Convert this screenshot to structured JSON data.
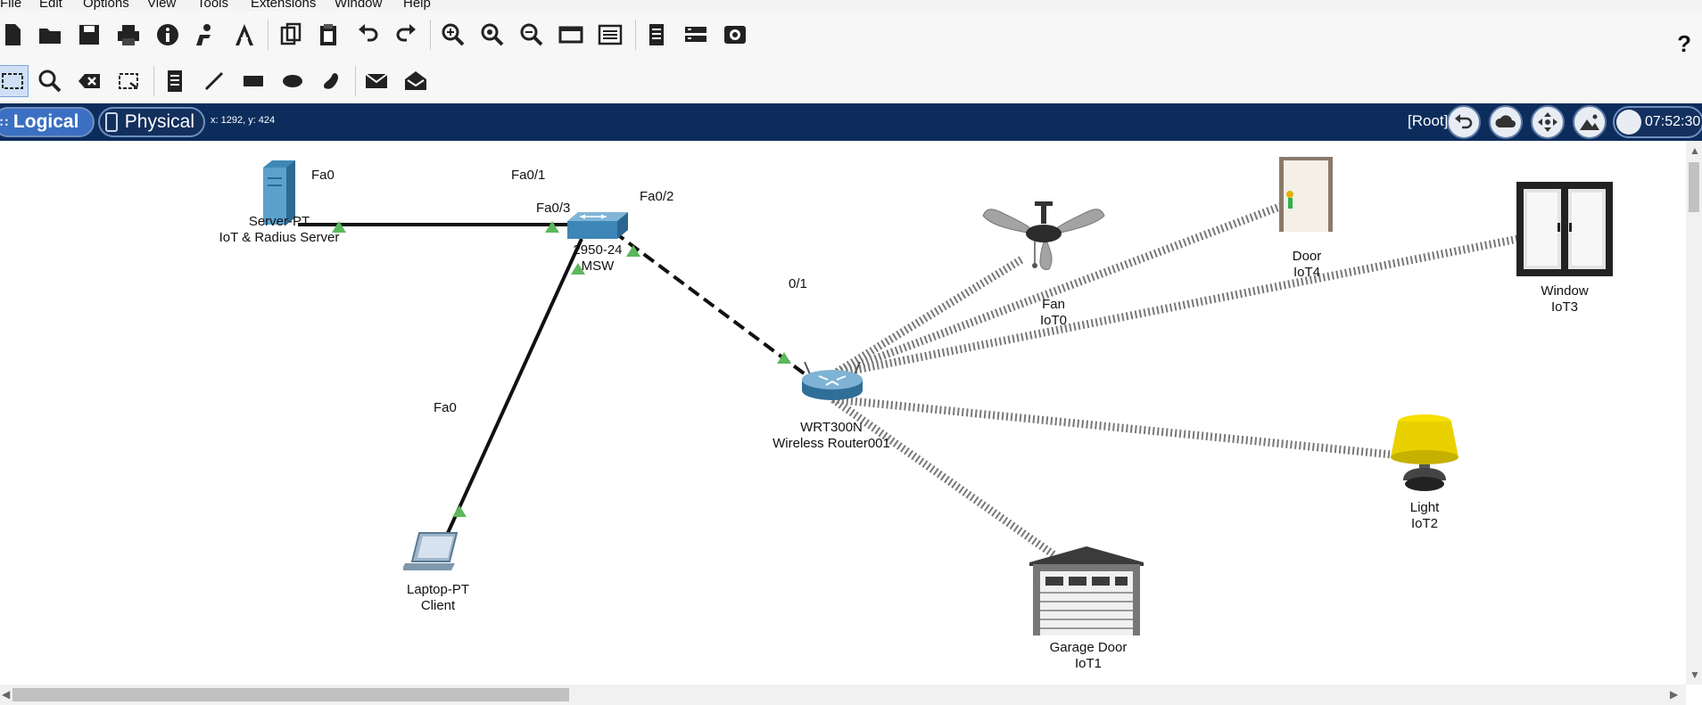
{
  "menu": [
    "File",
    "Edit",
    "Options",
    "View",
    "Tools",
    "Extensions",
    "Window",
    "Help"
  ],
  "toolbar": {
    "help_label": "?",
    "main_icons": [
      "new-file-icon",
      "open-folder-icon",
      "save-icon",
      "print-icon",
      "info-icon",
      "activity-wizard-icon",
      "network-info-icon",
      "copy-icon",
      "paste-icon",
      "undo-icon",
      "redo-icon",
      "zoom-in-icon",
      "zoom-reset-icon",
      "zoom-out-icon",
      "drawing-palette-icon",
      "custom-device-dialog-icon",
      "viewport-icon",
      "pdu-list-icon",
      "screenshot-icon"
    ],
    "tool_icons": [
      "select-tool-icon",
      "inspect-tool-icon",
      "delete-tool-icon",
      "resize-shape-icon",
      "place-note-icon",
      "draw-line-icon",
      "draw-rectangle-icon",
      "draw-ellipse-icon",
      "freeform-icon",
      "simple-pdu-icon",
      "complex-pdu-icon"
    ]
  },
  "modebar": {
    "logical_label": "Logical",
    "physical_label": "Physical",
    "coords": "x: 1292, y: 424",
    "root_label": "[Root]",
    "nav_icons": [
      "back-icon",
      "cloud-icon",
      "move-icon",
      "background-image-icon",
      "viewport-icon"
    ],
    "clock": "07:52:30"
  },
  "devices": {
    "server": {
      "model": "Server-PT",
      "name": "IoT & Radius Server"
    },
    "switch": {
      "model": "2950-24",
      "name": "MSW"
    },
    "router": {
      "model": "WRT300N",
      "name": "Wireless Router001"
    },
    "laptop": {
      "model": "Laptop-PT",
      "name": "Client"
    },
    "fan": {
      "model": "Fan",
      "name": "IoT0"
    },
    "door": {
      "model": "Door",
      "name": "IoT4"
    },
    "window": {
      "model": "Window",
      "name": "IoT3"
    },
    "light": {
      "model": "Light",
      "name": "IoT2"
    },
    "garage": {
      "model": "Garage Door",
      "name": "IoT1"
    }
  },
  "ports": {
    "server_fa0": "Fa0",
    "switch_fa01": "Fa0/1",
    "switch_fa02": "Fa0/2",
    "switch_fa03": "Fa0/3",
    "router_01": "0/1",
    "laptop_fa0": "Fa0"
  },
  "colors": {
    "modebar": "#0c2d5c",
    "link_up": "#5cb85c",
    "wireless": "#555555"
  }
}
